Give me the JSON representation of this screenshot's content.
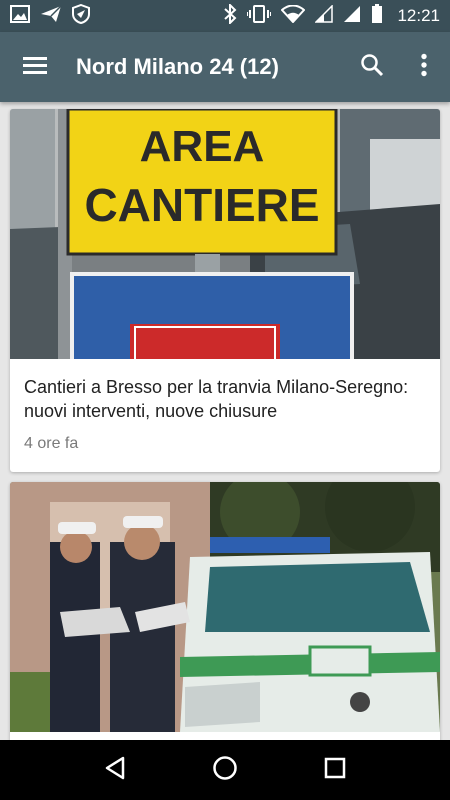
{
  "status_bar": {
    "time": "12:21",
    "left_icons": [
      "image-icon",
      "send-icon",
      "shield-icon"
    ],
    "right_icons": [
      "bluetooth-icon",
      "vibrate-icon",
      "wifi-icon",
      "signal-icon",
      "signal-icon",
      "battery-icon"
    ]
  },
  "app_bar": {
    "title": "Nord Milano 24 (12)",
    "icons": [
      "menu-icon",
      "search-icon",
      "more-vert-icon"
    ],
    "color": "#4b626c"
  },
  "articles": [
    {
      "title": "Cantieri a Bresso per la tranvia Milano-Seregno: nuovi interventi, nuove chiusure",
      "time": "4 ore fa",
      "image_sign_text_1": "AREA",
      "image_sign_text_2": "CANTIERE"
    },
    {
      "title": "",
      "time": ""
    }
  ],
  "nav_bar": {
    "icons": [
      "back-icon",
      "home-icon",
      "recents-icon"
    ]
  }
}
